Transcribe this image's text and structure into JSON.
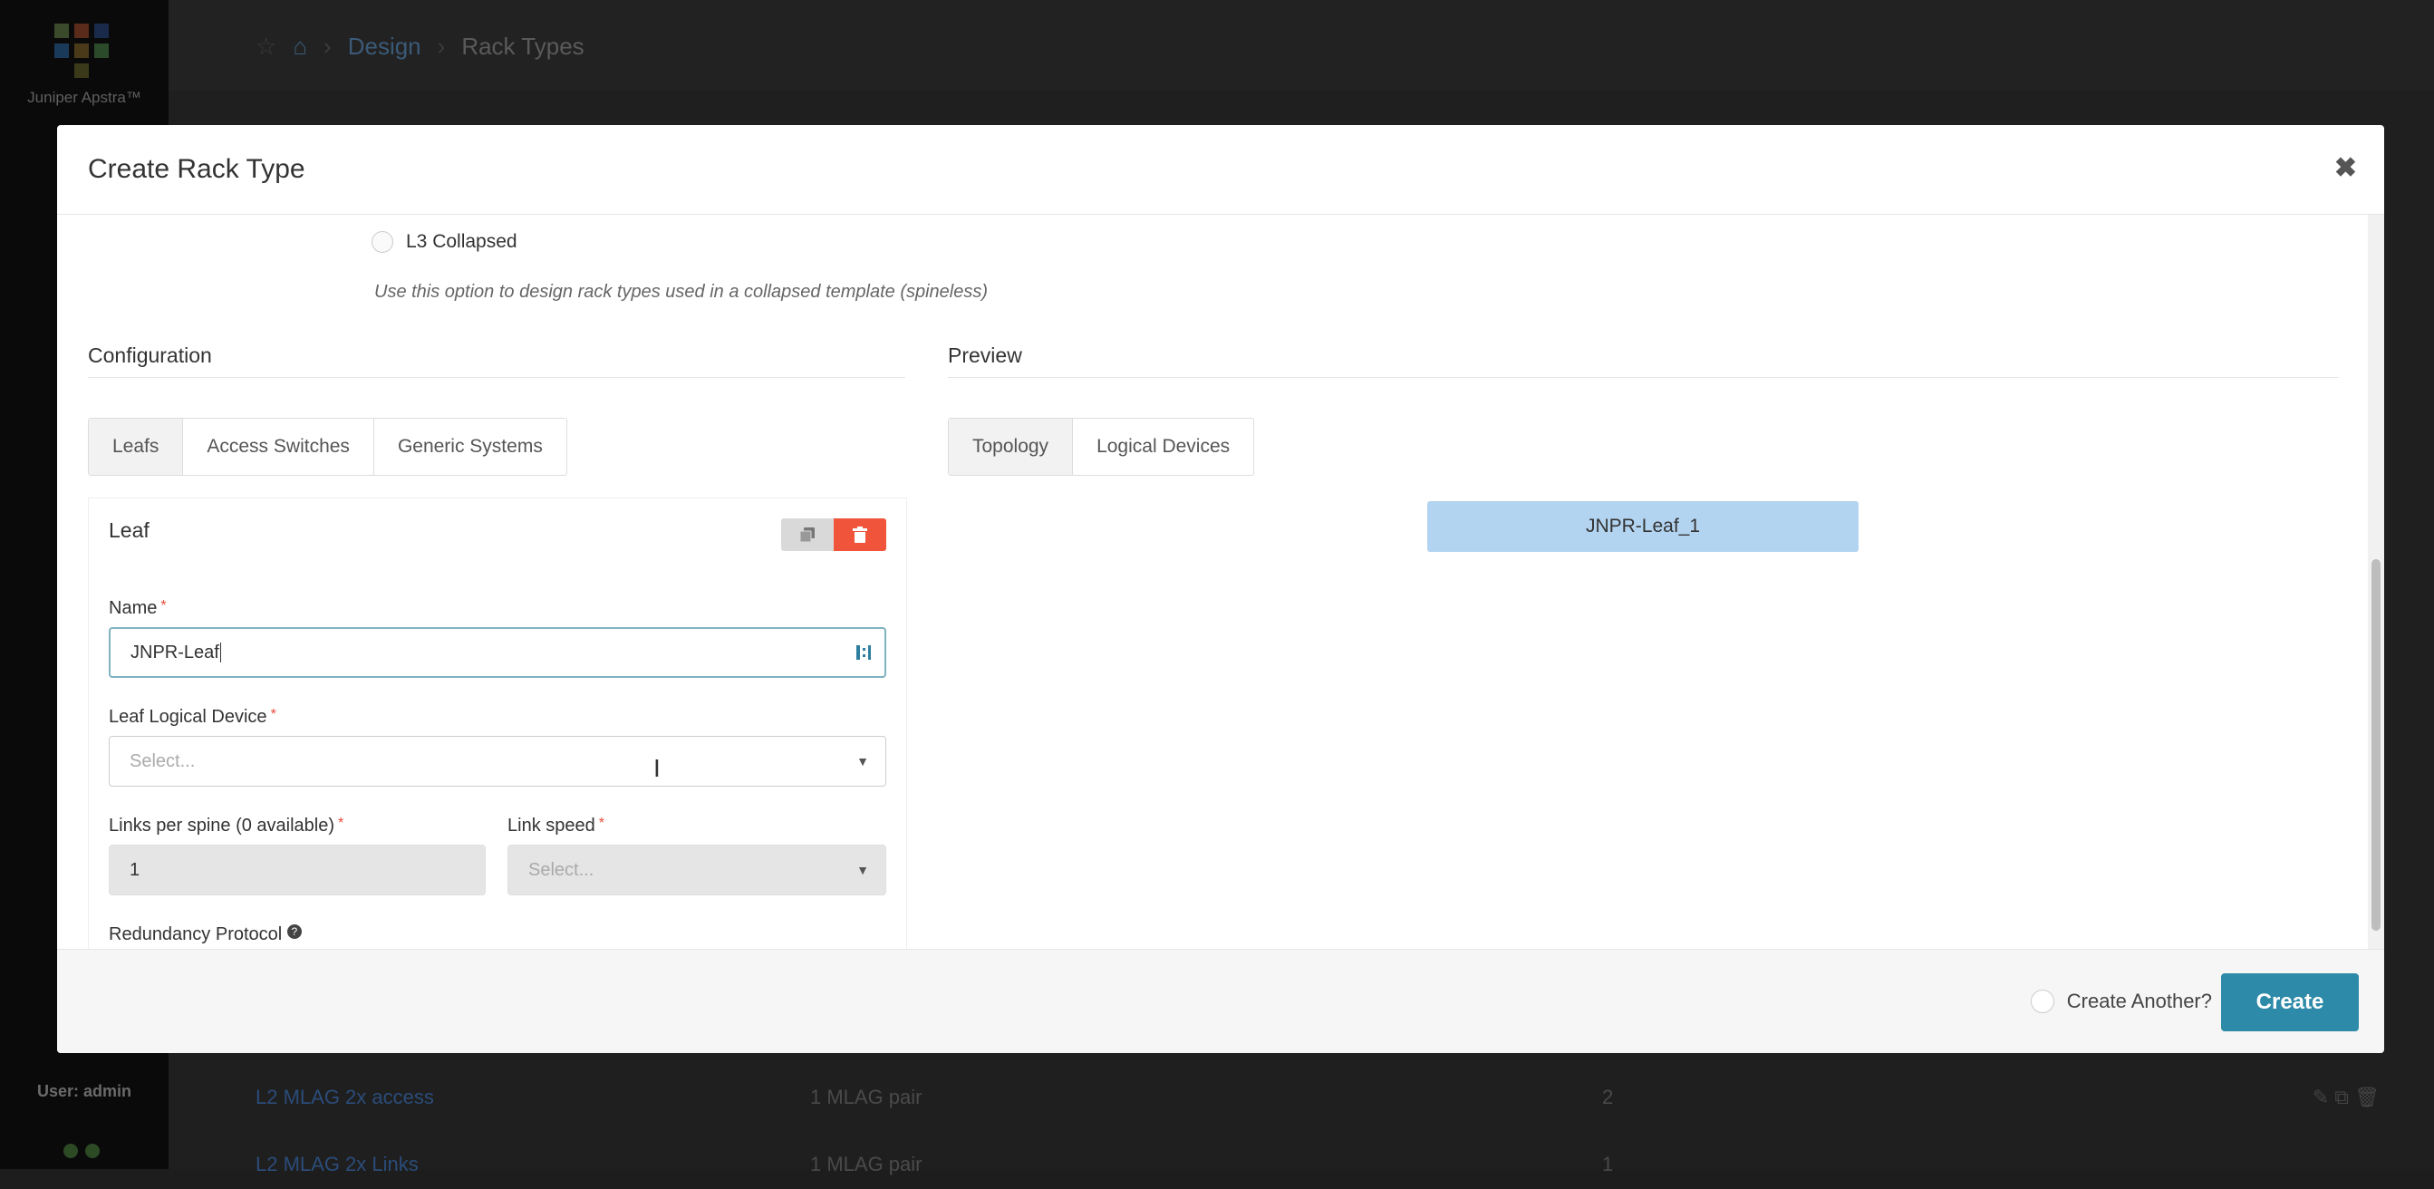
{
  "sidebar": {
    "brand": "Juniper Apstra™",
    "user": "User: admin",
    "colors": {
      "logo": [
        "#3a6b35",
        "#8a3a2a",
        "#2b4a7a",
        "#6b6b2a"
      ]
    }
  },
  "breadcrumb": {
    "items": [
      "Design",
      "Rack Types"
    ]
  },
  "background_rows": [
    {
      "name": "L2 MLAG 2x access",
      "leafs": "1 MLAG pair",
      "count": "2"
    },
    {
      "name": "L2 MLAG 2x Links",
      "leafs": "1 MLAG pair",
      "count": "1"
    }
  ],
  "modal": {
    "title": "Create Rack Type",
    "l3_option": {
      "label": "L3 Collapsed",
      "help": "Use this option to design rack types used in a collapsed template (spineless)"
    },
    "configuration": {
      "heading": "Configuration",
      "tabs": [
        "Leafs",
        "Access Switches",
        "Generic Systems"
      ],
      "active_tab": "Leafs",
      "leaf": {
        "title": "Leaf",
        "name_label": "Name",
        "name_value": "JNPR-Leaf",
        "logical_device_label": "Leaf Logical Device",
        "logical_device_placeholder": "Select...",
        "links_label": "Links per spine (0 available)",
        "links_value": "1",
        "link_speed_label": "Link speed",
        "link_speed_placeholder": "Select...",
        "redundancy_label": "Redundancy Protocol"
      }
    },
    "preview": {
      "heading": "Preview",
      "tabs": [
        "Topology",
        "Logical Devices"
      ],
      "active_tab": "Topology",
      "node_label": "JNPR-Leaf_1"
    },
    "footer": {
      "create_another_label": "Create Another?",
      "create_label": "Create"
    }
  },
  "icons": {
    "close": "close-icon",
    "clone": "clone-icon",
    "trash": "trash-icon",
    "home": "home-icon",
    "star": "star-icon"
  },
  "colors": {
    "accent": "#2d8aa8",
    "danger": "#f0553b",
    "preview_node": "#b3d4f0",
    "focus_border": "#7fb3c0"
  }
}
